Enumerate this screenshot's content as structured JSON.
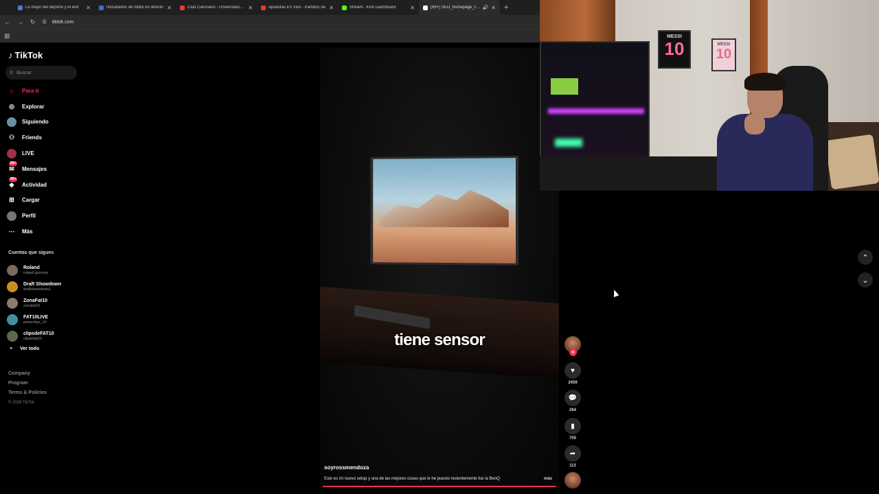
{
  "browser": {
    "tabs": [
      {
        "label": "Lo mejor del deporte y el entr",
        "color": "#4f7bd6",
        "active": false
      },
      {
        "label": "Resultados de fútbol en directo",
        "color": "#3c6cd8",
        "active": false
      },
      {
        "label": "Club Cienciano - Universitario de",
        "color": "#e33b2e",
        "active": false
      },
      {
        "label": "Apuestas En Vivo - Partidos de",
        "color": "#e33b2e",
        "active": false
      },
      {
        "label": "Stream - Kick Dashboard",
        "color": "#53fc18",
        "active": false
      },
      {
        "label": "(99+) SEO_homepage_title",
        "color": "#ffffff",
        "active": true
      }
    ],
    "url": "tiktok.com"
  },
  "sidebar": {
    "logo": "TikTok",
    "search_placeholder": "Buscar",
    "nav": [
      {
        "label": "Para ti",
        "icon": "home-icon",
        "glyph": "⌂",
        "active": true,
        "badge": ""
      },
      {
        "label": "Explorar",
        "icon": "compass-icon",
        "glyph": "◎",
        "active": false,
        "badge": ""
      },
      {
        "label": "Siguiendo",
        "icon": "following-avatar-icon",
        "glyph": "●",
        "active": false,
        "badge": ""
      },
      {
        "label": "Friends",
        "icon": "friends-icon",
        "glyph": "👥",
        "active": false,
        "badge": ""
      },
      {
        "label": "LIVE",
        "icon": "live-icon",
        "glyph": "●",
        "active": false,
        "badge": ""
      },
      {
        "label": "Mensajes",
        "icon": "messages-icon",
        "glyph": "✉",
        "active": false,
        "badge": "99+"
      },
      {
        "label": "Actividad",
        "icon": "activity-icon",
        "glyph": "◆",
        "active": false,
        "badge": "99+"
      },
      {
        "label": "Cargar",
        "icon": "upload-icon",
        "glyph": "⊞",
        "active": false,
        "badge": ""
      },
      {
        "label": "Perfil",
        "icon": "profile-icon",
        "glyph": "●",
        "active": false,
        "badge": ""
      },
      {
        "label": "Más",
        "icon": "more-icon",
        "glyph": "⋯",
        "active": false,
        "badge": ""
      }
    ],
    "following_header": "Cuentas que sigues",
    "accounts": [
      {
        "name": "Roland",
        "handle": "roland.guzman"
      },
      {
        "name": "Draft Showdown",
        "handle": "draftshowdown1"
      },
      {
        "name": "ZonaFat10",
        "handle": "zonafat10"
      },
      {
        "name": "FAT10LIVE",
        "handle": "pelaoclips_10"
      },
      {
        "name": "clipsdeFAT10",
        "handle": "clipdefat10"
      }
    ],
    "see_all": "Ver todo",
    "footer": {
      "company": "Company",
      "program": "Program",
      "terms": "Terms & Policies",
      "copyright": "© 2026 TikTok"
    }
  },
  "video": {
    "caption": "tiene sensor",
    "author": "soyrossmendoza",
    "description": "Este es mi nuevo setup y una de las mejores cosas que le he puesto recientemente fue la BenQ",
    "more": "más",
    "progress": 1.0
  },
  "actions": {
    "likes": "2459",
    "comments": "264",
    "saves": "705",
    "shares": "113"
  },
  "webcam": {
    "jersey1": {
      "name": "MESSI",
      "number": "10"
    },
    "jersey2": {
      "name": "MESSI",
      "number": "10"
    }
  },
  "colors": {
    "accent": "#fe2c55",
    "background": "#000000"
  }
}
